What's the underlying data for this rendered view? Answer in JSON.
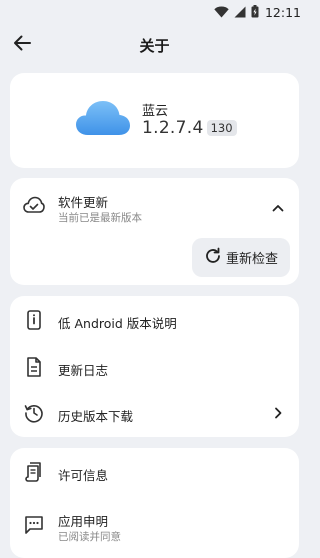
{
  "status_bar": {
    "time": "12:11",
    "icons": [
      "wifi-icon",
      "signal-icon",
      "battery-icon"
    ]
  },
  "header": {
    "title": "关于",
    "back_icon": "arrow-left-icon"
  },
  "app_info": {
    "logo_icon": "cloud-icon",
    "name": "蓝云",
    "version": "1.2.7.4",
    "version_code": "130"
  },
  "update": {
    "title": "软件更新",
    "subtitle": "当前已是最新版本",
    "icon": "cloud-check-icon",
    "expand_icon": "chevron-up-icon",
    "recheck_label": "重新检查",
    "recheck_icon": "refresh-icon"
  },
  "info_items": [
    {
      "label": "低 Android 版本说明",
      "icon": "phone-info-icon"
    },
    {
      "label": "更新日志",
      "icon": "document-icon"
    },
    {
      "label": "历史版本下载",
      "icon": "history-icon",
      "chevron": "chevron-right-icon"
    }
  ],
  "legal_items": [
    {
      "label": "许可信息",
      "icon": "scroll-icon"
    },
    {
      "label": "应用申明",
      "subtitle": "已阅读并同意",
      "icon": "message-icon"
    }
  ],
  "colors": {
    "background": "#eef0f4",
    "card": "#ffffff",
    "accent_cloud": "#5aa7f0"
  }
}
